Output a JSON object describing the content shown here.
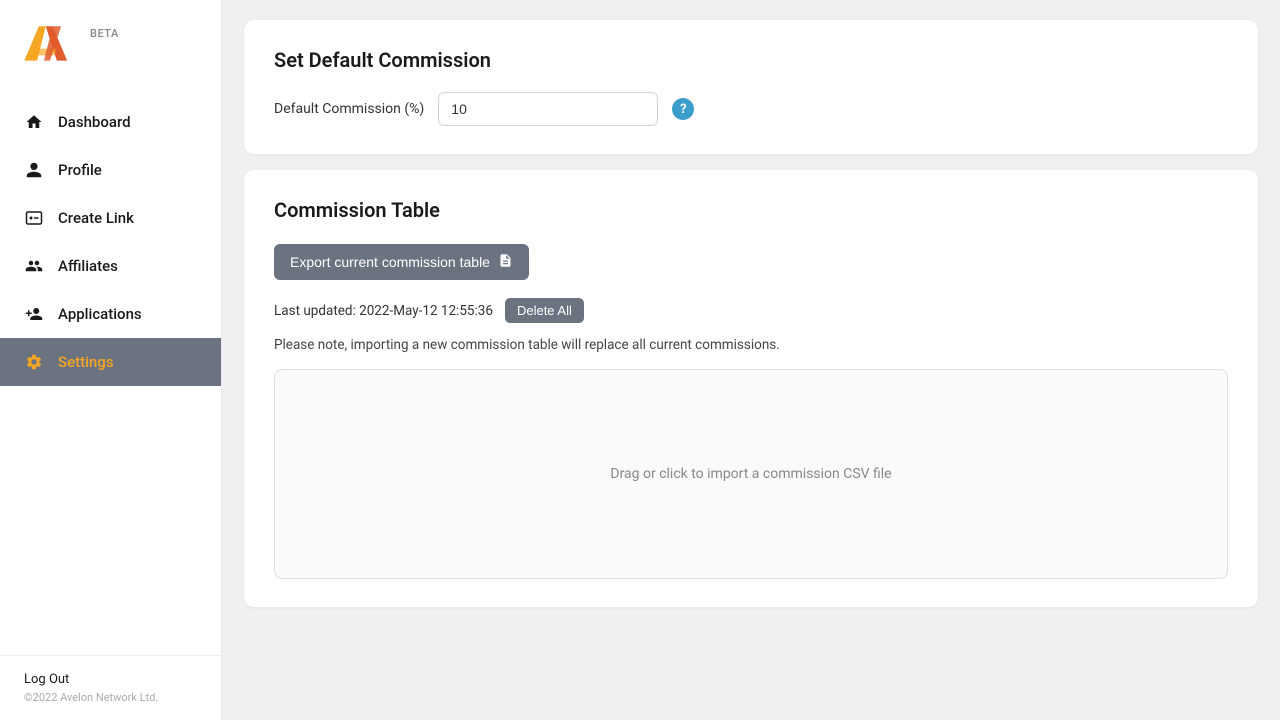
{
  "brand": {
    "logo_alt": "AV Logo",
    "beta_label": "BETA"
  },
  "sidebar": {
    "nav_items": [
      {
        "id": "dashboard",
        "label": "Dashboard",
        "icon": "home-icon",
        "active": false
      },
      {
        "id": "profile",
        "label": "Profile",
        "icon": "user-icon",
        "active": false
      },
      {
        "id": "create-link",
        "label": "Create Link",
        "icon": "link-icon",
        "active": false
      },
      {
        "id": "affiliates",
        "label": "Affiliates",
        "icon": "users-icon",
        "active": false
      },
      {
        "id": "applications",
        "label": "Applications",
        "icon": "user-plus-icon",
        "active": false
      },
      {
        "id": "settings",
        "label": "Settings",
        "icon": "gear-icon",
        "active": true
      }
    ],
    "log_out_label": "Log Out",
    "copyright": "©2022 Avelon Network Ltd."
  },
  "main": {
    "default_commission": {
      "card_title": "Set Default Commission",
      "label": "Default Commission (%)",
      "input_value": "10",
      "help_icon_label": "?"
    },
    "commission_table": {
      "card_title": "Commission Table",
      "export_btn_label": "Export current commission table",
      "last_updated_label": "Last updated: 2022-May-12 12:55:36",
      "delete_all_label": "Delete All",
      "import_notice": "Please note, importing a new commission table will replace all current commissions.",
      "drop_zone_text": "Drag or click to import a commission CSV file"
    }
  }
}
